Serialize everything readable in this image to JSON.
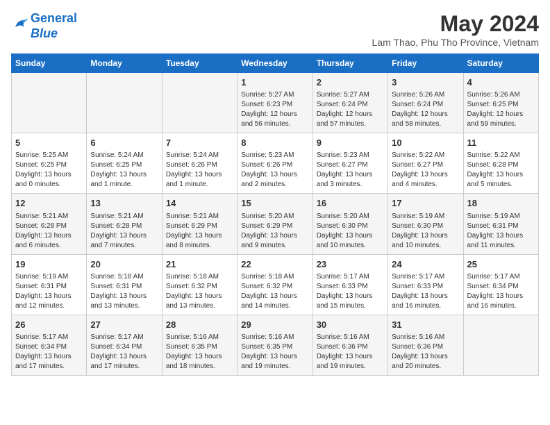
{
  "header": {
    "logo_line1": "General",
    "logo_line2": "Blue",
    "main_title": "May 2024",
    "subtitle": "Lam Thao, Phu Tho Province, Vietnam"
  },
  "days_of_week": [
    "Sunday",
    "Monday",
    "Tuesday",
    "Wednesday",
    "Thursday",
    "Friday",
    "Saturday"
  ],
  "weeks": [
    [
      {
        "day": "",
        "info": ""
      },
      {
        "day": "",
        "info": ""
      },
      {
        "day": "",
        "info": ""
      },
      {
        "day": "1",
        "info": "Sunrise: 5:27 AM\nSunset: 6:23 PM\nDaylight: 12 hours\nand 56 minutes."
      },
      {
        "day": "2",
        "info": "Sunrise: 5:27 AM\nSunset: 6:24 PM\nDaylight: 12 hours\nand 57 minutes."
      },
      {
        "day": "3",
        "info": "Sunrise: 5:26 AM\nSunset: 6:24 PM\nDaylight: 12 hours\nand 58 minutes."
      },
      {
        "day": "4",
        "info": "Sunrise: 5:26 AM\nSunset: 6:25 PM\nDaylight: 12 hours\nand 59 minutes."
      }
    ],
    [
      {
        "day": "5",
        "info": "Sunrise: 5:25 AM\nSunset: 6:25 PM\nDaylight: 13 hours\nand 0 minutes."
      },
      {
        "day": "6",
        "info": "Sunrise: 5:24 AM\nSunset: 6:25 PM\nDaylight: 13 hours\nand 1 minute."
      },
      {
        "day": "7",
        "info": "Sunrise: 5:24 AM\nSunset: 6:26 PM\nDaylight: 13 hours\nand 1 minute."
      },
      {
        "day": "8",
        "info": "Sunrise: 5:23 AM\nSunset: 6:26 PM\nDaylight: 13 hours\nand 2 minutes."
      },
      {
        "day": "9",
        "info": "Sunrise: 5:23 AM\nSunset: 6:27 PM\nDaylight: 13 hours\nand 3 minutes."
      },
      {
        "day": "10",
        "info": "Sunrise: 5:22 AM\nSunset: 6:27 PM\nDaylight: 13 hours\nand 4 minutes."
      },
      {
        "day": "11",
        "info": "Sunrise: 5:22 AM\nSunset: 6:28 PM\nDaylight: 13 hours\nand 5 minutes."
      }
    ],
    [
      {
        "day": "12",
        "info": "Sunrise: 5:21 AM\nSunset: 6:28 PM\nDaylight: 13 hours\nand 6 minutes."
      },
      {
        "day": "13",
        "info": "Sunrise: 5:21 AM\nSunset: 6:28 PM\nDaylight: 13 hours\nand 7 minutes."
      },
      {
        "day": "14",
        "info": "Sunrise: 5:21 AM\nSunset: 6:29 PM\nDaylight: 13 hours\nand 8 minutes."
      },
      {
        "day": "15",
        "info": "Sunrise: 5:20 AM\nSunset: 6:29 PM\nDaylight: 13 hours\nand 9 minutes."
      },
      {
        "day": "16",
        "info": "Sunrise: 5:20 AM\nSunset: 6:30 PM\nDaylight: 13 hours\nand 10 minutes."
      },
      {
        "day": "17",
        "info": "Sunrise: 5:19 AM\nSunset: 6:30 PM\nDaylight: 13 hours\nand 10 minutes."
      },
      {
        "day": "18",
        "info": "Sunrise: 5:19 AM\nSunset: 6:31 PM\nDaylight: 13 hours\nand 11 minutes."
      }
    ],
    [
      {
        "day": "19",
        "info": "Sunrise: 5:19 AM\nSunset: 6:31 PM\nDaylight: 13 hours\nand 12 minutes."
      },
      {
        "day": "20",
        "info": "Sunrise: 5:18 AM\nSunset: 6:31 PM\nDaylight: 13 hours\nand 13 minutes."
      },
      {
        "day": "21",
        "info": "Sunrise: 5:18 AM\nSunset: 6:32 PM\nDaylight: 13 hours\nand 13 minutes."
      },
      {
        "day": "22",
        "info": "Sunrise: 5:18 AM\nSunset: 6:32 PM\nDaylight: 13 hours\nand 14 minutes."
      },
      {
        "day": "23",
        "info": "Sunrise: 5:17 AM\nSunset: 6:33 PM\nDaylight: 13 hours\nand 15 minutes."
      },
      {
        "day": "24",
        "info": "Sunrise: 5:17 AM\nSunset: 6:33 PM\nDaylight: 13 hours\nand 16 minutes."
      },
      {
        "day": "25",
        "info": "Sunrise: 5:17 AM\nSunset: 6:34 PM\nDaylight: 13 hours\nand 16 minutes."
      }
    ],
    [
      {
        "day": "26",
        "info": "Sunrise: 5:17 AM\nSunset: 6:34 PM\nDaylight: 13 hours\nand 17 minutes."
      },
      {
        "day": "27",
        "info": "Sunrise: 5:17 AM\nSunset: 6:34 PM\nDaylight: 13 hours\nand 17 minutes."
      },
      {
        "day": "28",
        "info": "Sunrise: 5:16 AM\nSunset: 6:35 PM\nDaylight: 13 hours\nand 18 minutes."
      },
      {
        "day": "29",
        "info": "Sunrise: 5:16 AM\nSunset: 6:35 PM\nDaylight: 13 hours\nand 19 minutes."
      },
      {
        "day": "30",
        "info": "Sunrise: 5:16 AM\nSunset: 6:36 PM\nDaylight: 13 hours\nand 19 minutes."
      },
      {
        "day": "31",
        "info": "Sunrise: 5:16 AM\nSunset: 6:36 PM\nDaylight: 13 hours\nand 20 minutes."
      },
      {
        "day": "",
        "info": ""
      }
    ]
  ]
}
